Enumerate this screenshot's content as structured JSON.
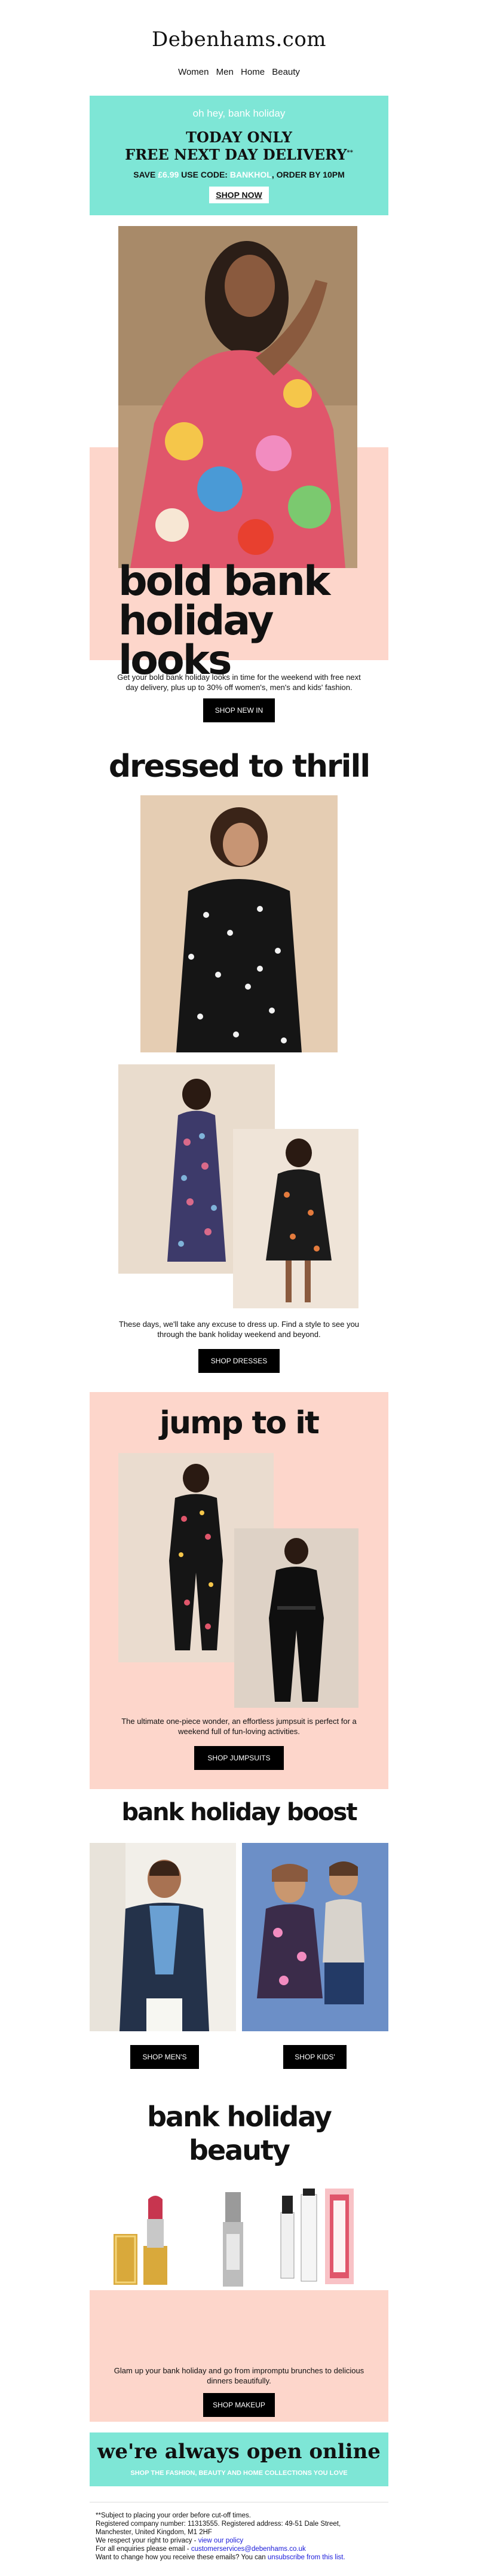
{
  "brand": {
    "logo": "Debenhams.com",
    "accent": "#7ee6d6",
    "pink": "#fdd6cb"
  },
  "nav": {
    "items": [
      "Women",
      "Men",
      "Home",
      "Beauty"
    ]
  },
  "promo": {
    "greeting": "oh hey, bank holiday",
    "line1": "TODAY ONLY",
    "line2": "FREE NEXT DAY DELIVERY",
    "line2_sup": "**",
    "code_prefix": "SAVE",
    "code_price": "£6.99",
    "code_mid": "USE CODE:",
    "code_value": "BANKHOL",
    "code_suffix": "ORDER BY 10PM",
    "cta": "SHOP NOW"
  },
  "hero": {
    "title_line1": "bold bank",
    "title_line2": "holiday looks",
    "text": "Get your bold bank holiday looks in time for the weekend with free next day delivery, plus up to 30% off women's, men's and kids' fashion.",
    "cta": "SHOP NEW IN"
  },
  "dresses": {
    "title": "dressed to thrill",
    "text": "These days, we'll take any excuse to dress up. Find a style to see you through the bank holiday weekend and beyond.",
    "cta": "SHOP DRESSES"
  },
  "jumpsuits": {
    "title": "jump to it",
    "text": "The ultimate one-piece wonder, an effortless jumpsuit is perfect for a weekend full of fun-loving activities.",
    "cta": "SHOP JUMPSUITS"
  },
  "boost": {
    "title": "bank holiday boost",
    "cta_men": "SHOP MEN'S",
    "cta_kids": "SHOP KIDS'"
  },
  "beauty": {
    "title_line1": "bank holiday",
    "title_line2": "beauty",
    "text": "Glam up your bank holiday and go from impromptu brunches to delicious dinners beautifully.",
    "cta": "SHOP MAKEUP"
  },
  "always_open": {
    "title": "we're always open online",
    "subtitle": "SHOP THE FASHION, BEAUTY AND HOME COLLECTIONS YOU LOVE"
  },
  "footer": {
    "l1": "**Subject to placing your order before cut-off times.",
    "l2": "Registered company number: 11313555. Registered address: 49-51 Dale Street,",
    "l3": "Manchester, United Kingdom, M1 2HF",
    "l4_prefix": "We respect your right to privacy -",
    "l4_link": "view our policy",
    "l5_prefix": "For all enquiries please email -",
    "l5_link": "customerservices@debenhams.co.uk",
    "l6_prefix": "Want to change how you receive these emails? You can",
    "l6_link": "unsubscribe from this list."
  }
}
